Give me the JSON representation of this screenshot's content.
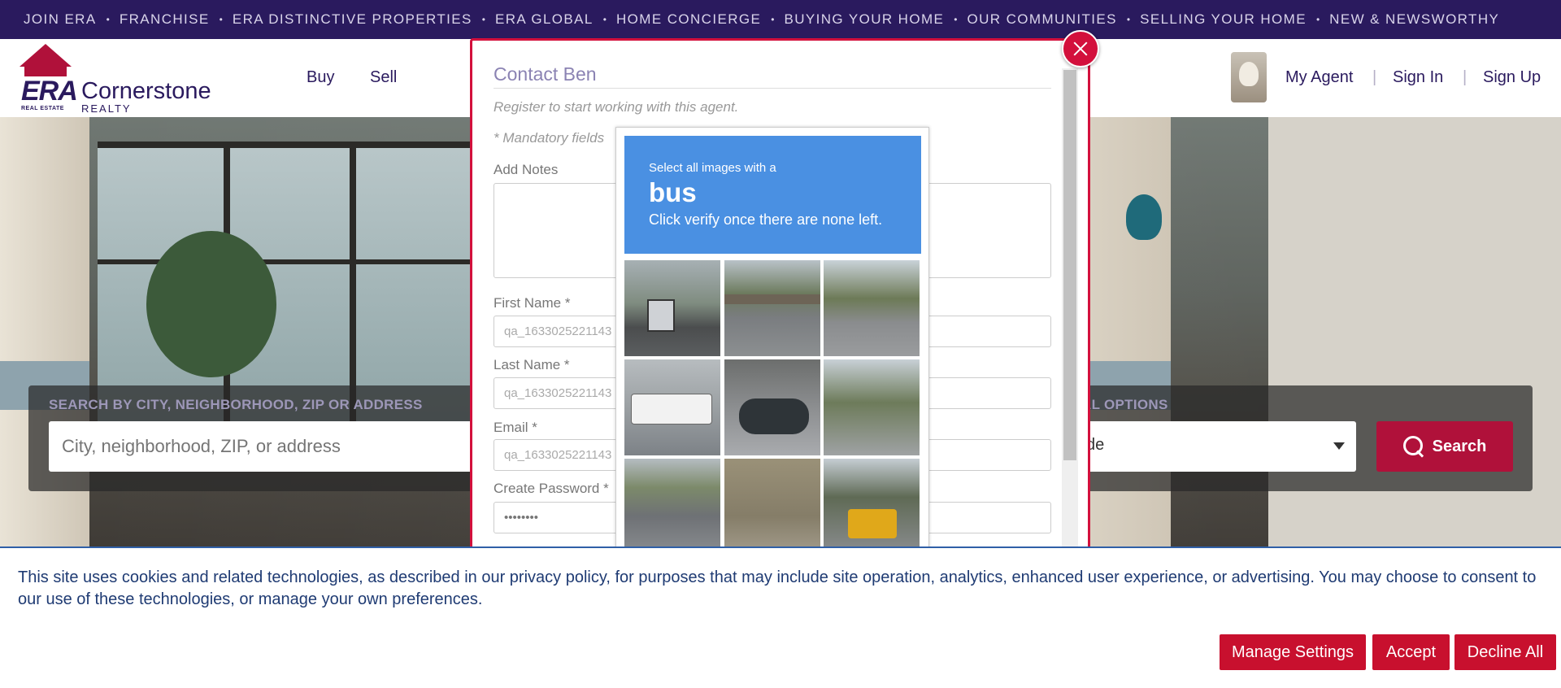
{
  "top_nav": {
    "items": [
      "JOIN ERA",
      "FRANCHISE",
      "ERA DISTINCTIVE PROPERTIES",
      "ERA GLOBAL",
      "HOME CONCIERGE",
      "BUYING YOUR HOME",
      "OUR COMMUNITIES",
      "SELLING YOUR HOME",
      "NEW & NEWSWORTHY"
    ],
    "separator": "•"
  },
  "header": {
    "logo": {
      "era": "ERA",
      "real_estate": "REAL ESTATE",
      "brand": "Cornerstone",
      "realty": "REALTY"
    },
    "nav": {
      "buy": "Buy",
      "sell": "Sell"
    },
    "my_agent": "My Agent",
    "sign_in": "Sign In",
    "sign_up": "Sign Up",
    "separator": "|"
  },
  "search": {
    "label": "SEARCH BY CITY, NEIGHBORHOOD, ZIP OR ADDRESS",
    "label2": "AL OPTIONS",
    "placeholder": "City, neighborhood, ZIP, or address",
    "select_value": "de",
    "button": "Search"
  },
  "modal": {
    "title": "Contact Ben",
    "subtitle": "Register to start working with this agent.",
    "mandatory": "* Mandatory fields",
    "notes_label": "Add Notes",
    "first_name_label": "First Name *",
    "first_name_value": "qa_1633025221143",
    "last_name_label": "Last Name *",
    "last_name_value": "qa_1633025221143",
    "email_label": "Email *",
    "email_value": "qa_1633025221143",
    "password_label": "Create Password *",
    "password_value": "••••••••"
  },
  "captcha": {
    "line1": "Select all images with a",
    "target": "bus",
    "line2": "Click verify once there are none left.",
    "accent": "#4a90e2"
  },
  "cookie": {
    "text": "This site uses cookies and related technologies, as described in our privacy policy, for purposes that may include site operation, analytics, enhanced user experience, or advertising. You may choose to consent to our use of these technologies, or manage your own preferences.",
    "manage": "Manage Settings",
    "accept": "Accept",
    "decline": "Decline All"
  },
  "colors": {
    "brand_purple": "#2a1a5e",
    "brand_red": "#b0113a",
    "modal_border": "#d3103c",
    "cookie_button": "#c8102e"
  }
}
